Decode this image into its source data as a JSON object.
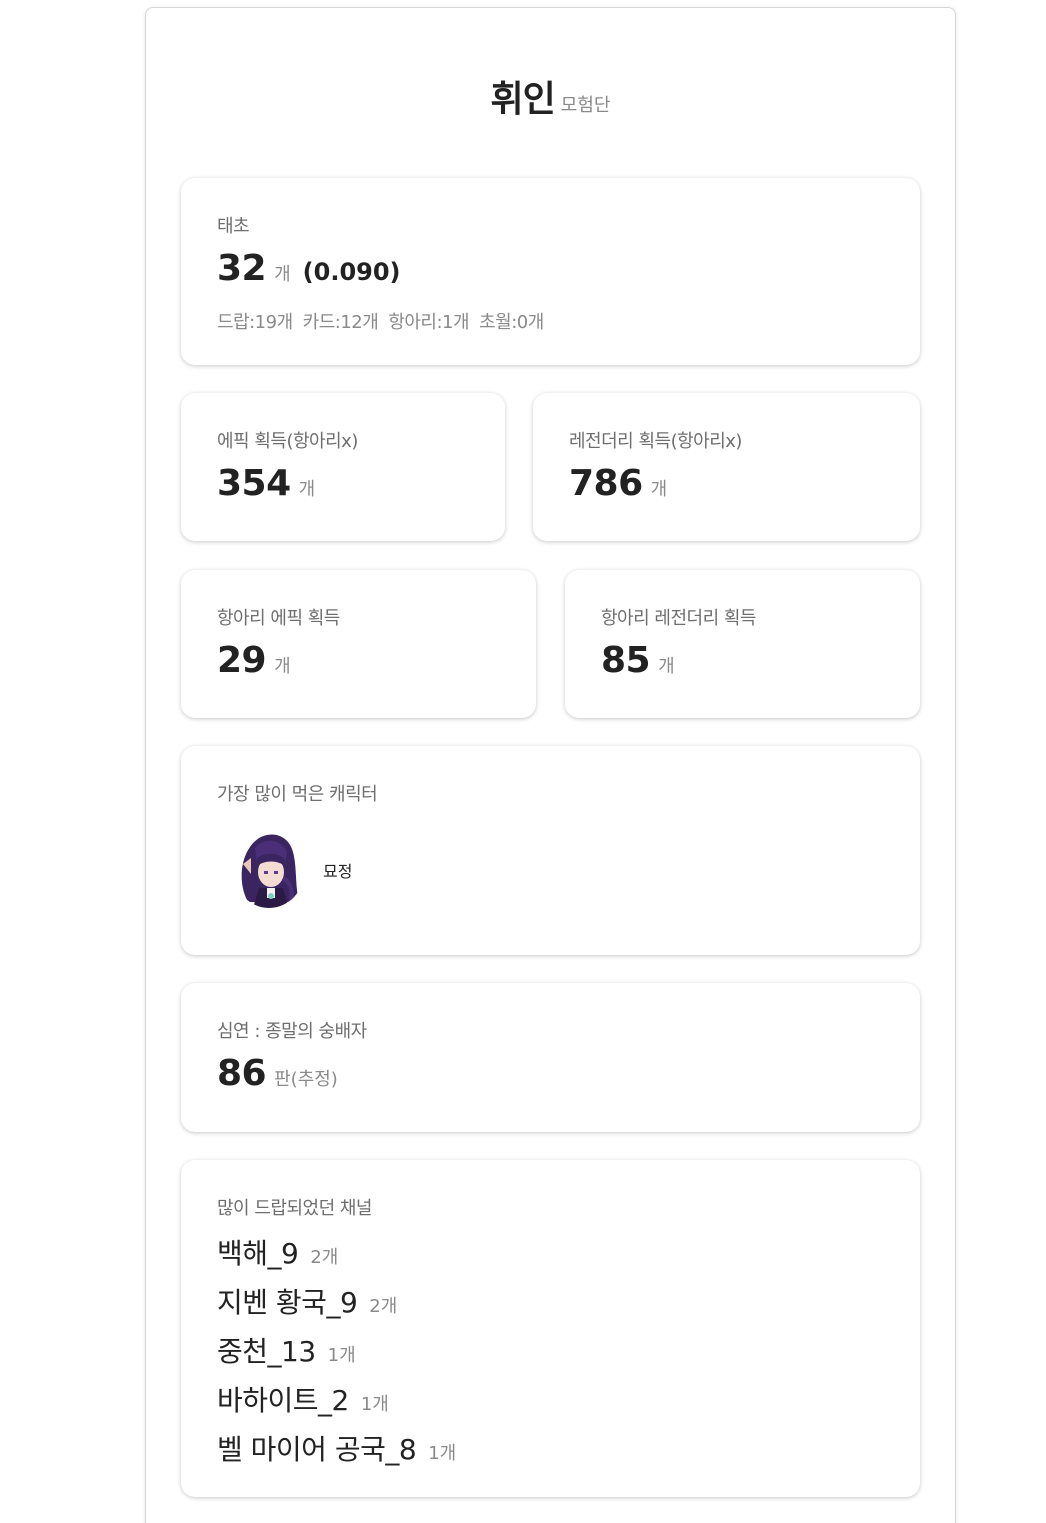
{
  "header": {
    "guild_name": "휘인",
    "guild_type": "모험단"
  },
  "taecho": {
    "label": "태초",
    "count": "32",
    "unit": "개",
    "ratio": "(0.090)",
    "breakdown": [
      "드랍:19개",
      "카드:12개",
      "항아리:1개",
      "초월:0개"
    ]
  },
  "epic_no_jar": {
    "label": "에픽 획득(항아리x)",
    "count": "354",
    "unit": "개"
  },
  "legendary_no_jar": {
    "label": "레전더리 획득(항아리x)",
    "count": "786",
    "unit": "개"
  },
  "jar_epic": {
    "label": "항아리 에픽 획득",
    "count": "29",
    "unit": "개"
  },
  "jar_legendary": {
    "label": "항아리 레전더리 획득",
    "count": "85",
    "unit": "개"
  },
  "top_character": {
    "label": "가장 많이 먹은 캐릭터",
    "name": "묘정"
  },
  "abyss": {
    "label": "심연 : 종말의 숭배자",
    "count": "86",
    "unit": "판(추정)"
  },
  "channels": {
    "label": "많이 드랍되었던 채널",
    "items": [
      {
        "name": "백해_9",
        "count": "2개"
      },
      {
        "name": "지벤 황국_9",
        "count": "2개"
      },
      {
        "name": "중천_13",
        "count": "1개"
      },
      {
        "name": "바하이트_2",
        "count": "1개"
      },
      {
        "name": "벨 마이어 공국_8",
        "count": "1개"
      }
    ]
  },
  "colors": {
    "text": "#222222",
    "label": "#6e6e6e",
    "muted": "#8a8a8a",
    "avatar_hair": "#3b2560"
  }
}
